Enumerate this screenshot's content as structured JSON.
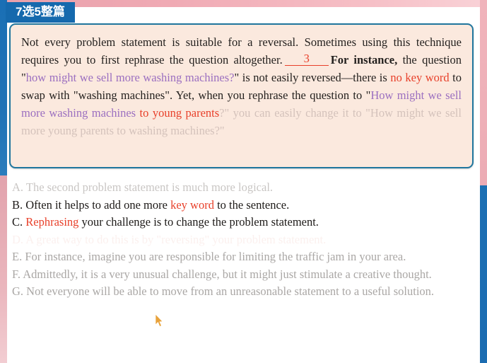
{
  "frame": {
    "accent_blue": "#1569ad",
    "accent_pink": "#eeb0b8",
    "card_bg": "#fbe9de",
    "card_border": "#20769e",
    "highlight_red": "#e8402a",
    "highlight_purple": "#9b6fc0"
  },
  "tab": {
    "label": "7选5整篇"
  },
  "passage": {
    "blank_number": "3",
    "segments": [
      {
        "text": "Not every problem statement is suitable for a reversal. Sometimes using this technique requires you to first rephrase the question altogether.",
        "style": "normal"
      },
      {
        "text": "3",
        "style": "blank"
      },
      {
        "text": "For instance,",
        "style": "bold"
      },
      {
        "text": " the question \"",
        "style": "normal"
      },
      {
        "text": "how might we sell more washing machines?",
        "style": "purple"
      },
      {
        "text": "\" is not easily reversed—there is ",
        "style": "normal"
      },
      {
        "text": "no key word",
        "style": "red"
      },
      {
        "text": " to swap with \"washing machines\". Yet, when you rephrase the question to \"",
        "style": "normal"
      },
      {
        "text": "How might we sell more washing machines",
        "style": "purple"
      },
      {
        "text": " to young parents",
        "style": "red"
      },
      {
        "text": "?\"",
        "style": "faded"
      },
      {
        "text": " you can easily change it to \"How might we sell more young parents to washing machines?\"",
        "style": "faded"
      }
    ],
    "plain_text": "Not every problem statement is suitable for a reversal. Sometimes using this technique requires you to first rephrase the question altogether. __3__ For instance, the question \"how might we sell more washing machines?\" is not easily reversed—there is no key word to swap with \"washing machines\". Yet, when you rephrase the question to \"How might we sell more washing machines to young parents?\" you can easily change it to \"How might we sell more young parents to washing machines?\""
  },
  "options": [
    {
      "letter": "A.",
      "text": "The second problem statement is much more logical.",
      "state": "dim",
      "full": "A. The second problem statement is much more logical."
    },
    {
      "letter": "B.",
      "text_before": "Often it helps to add one more ",
      "highlight": "key word",
      "text_after": " to the sentence.",
      "state": "active",
      "full": "B. Often it helps to add one more key word to the sentence."
    },
    {
      "letter": "C.",
      "highlight": "Rephrasing",
      "text_after": " your challenge is to change the problem statement.",
      "state": "active",
      "full": "C. Rephrasing your challenge is to change the problem statement."
    },
    {
      "letter": "D.",
      "text": "A great way to do this is by \"reversing\" your problem statement.",
      "state": "ghost",
      "full": "D. A great way to do this is by \"reversing\" your problem statement."
    },
    {
      "letter": "E.",
      "text": "For instance, imagine you are responsible for limiting the traffic jam in your area.",
      "state": "grey",
      "full": "E. For instance, imagine you are responsible for limiting the traffic jam in your area."
    },
    {
      "letter": "F.",
      "text": "Admittedly, it is a very unusual challenge, but it might just stimulate a creative thought.",
      "state": "grey",
      "full": "F. Admittedly, it is a very unusual challenge, but it might just stimulate a creative thought."
    },
    {
      "letter": "G.",
      "text": "Not everyone will be able to move from an unreasonable statement to a useful solution.",
      "state": "grey",
      "full": "G. Not everyone will be able to move from an unreasonable statement to a useful solution."
    }
  ],
  "cursor": {
    "icon": "pointer-arrow",
    "color": "#e8a23a"
  }
}
